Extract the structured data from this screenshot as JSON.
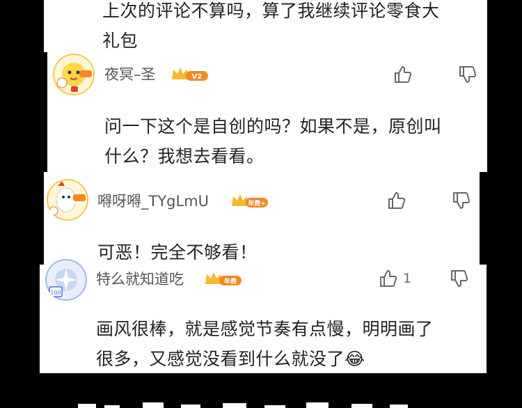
{
  "comments": [
    {
      "text_lines": [
        "上次的评论不算吗，算了我继续评论零食大",
        "礼包"
      ]
    },
    {
      "username": "夜冥–圣",
      "badge_label": "V2",
      "text_lines": [
        "问一下这个是自创的吗？如果不是，原创叫",
        "什么？我想去看看。"
      ]
    },
    {
      "username": "嘚呀嘚_TYgLmU",
      "badge_label": "年费+",
      "text_lines": [
        "可恶！完全不够看！"
      ]
    },
    {
      "username": "特么就知道吃",
      "badge_label": "年费",
      "like_count": "1",
      "text_lines": [
        "画风很棒，就是感觉节奏有点慢，明明画了",
        "很多，又感觉没看到什么就没了😂"
      ]
    }
  ],
  "colors": {
    "background": "#000000",
    "card": "#ffffff",
    "text": "#222222",
    "username": "#555555",
    "crown_gold": "#f5b82e",
    "badge_orange": "#f08a24"
  },
  "icons": [
    "thumb-up-icon",
    "thumb-down-icon",
    "crown-badge-icon",
    "avatar-chick-icon"
  ]
}
